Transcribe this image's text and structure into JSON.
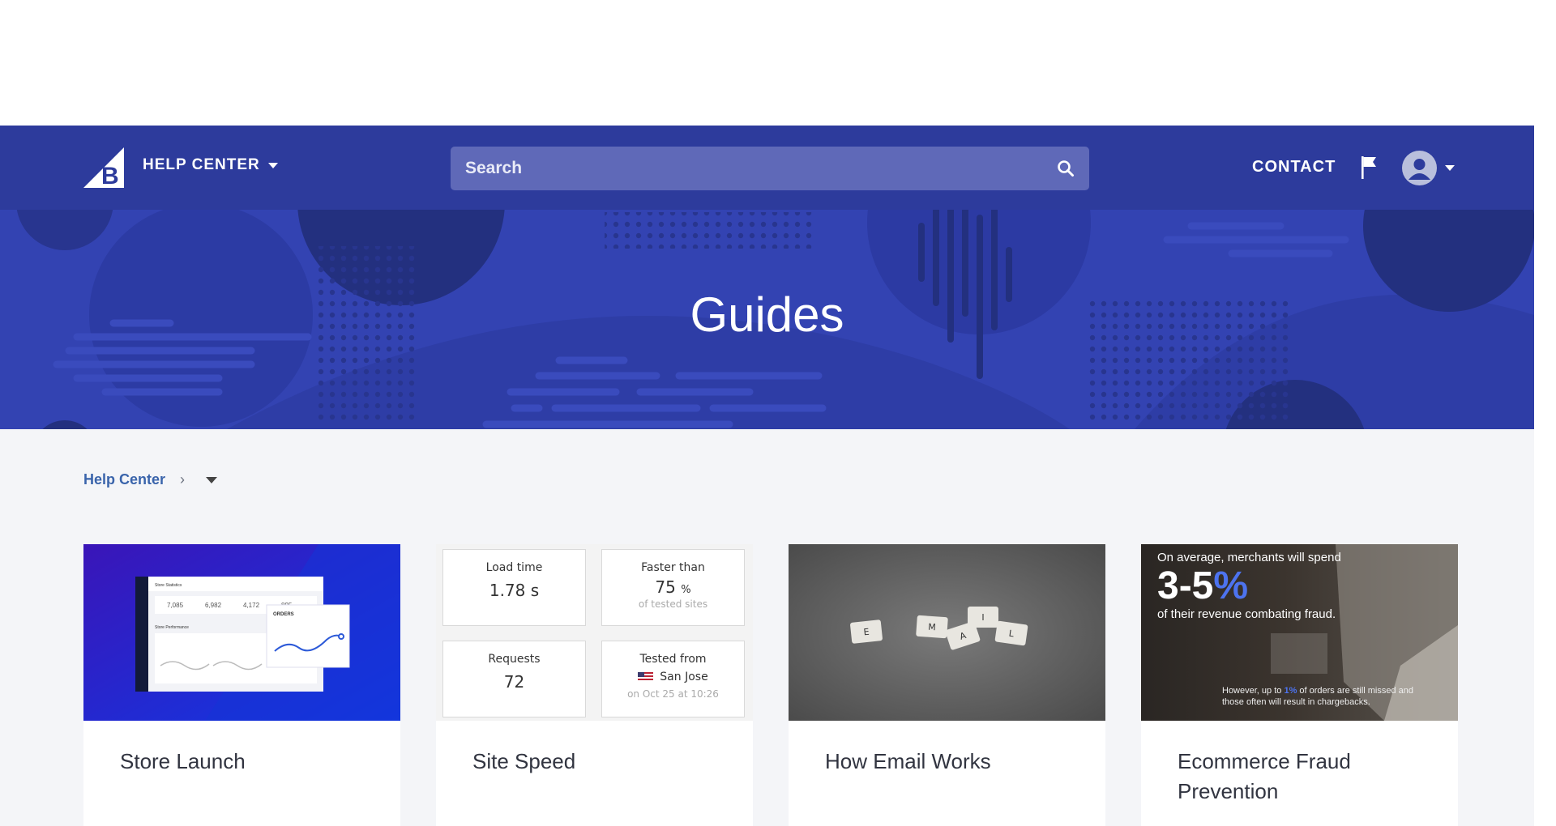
{
  "nav": {
    "help_center_label": "HELP CENTER",
    "search_placeholder": "Search",
    "contact_label": "CONTACT"
  },
  "hero": {
    "title": "Guides"
  },
  "breadcrumb": {
    "home": "Help Center",
    "separator": "›"
  },
  "cards": [
    {
      "title": "Store Launch",
      "image": {
        "stats": [
          "7,085",
          "6,982",
          "4,172",
          "895"
        ],
        "panel_label": "ORDERS",
        "header_label": "Store Statistics",
        "section_label": "Store Performance"
      }
    },
    {
      "title": "Site Speed",
      "image": {
        "load_time_label": "Load time",
        "load_time_value": "1.78 s",
        "faster_label": "Faster than",
        "faster_value": "75",
        "faster_unit": "%",
        "faster_sub": "of tested sites",
        "requests_label": "Requests",
        "requests_value": "72",
        "tested_label": "Tested from",
        "tested_location": "San Jose",
        "tested_date": "on Oct 25 at 10:26"
      }
    },
    {
      "title": "How Email Works",
      "image": {
        "tiles": [
          "E",
          "M",
          "A",
          "I",
          "L"
        ]
      }
    },
    {
      "title": "Ecommerce Fraud Prevention",
      "image": {
        "line1": "On average, merchants will spend",
        "big_number": "3-5",
        "big_pct": "%",
        "line2": "of their revenue combating fraud.",
        "footnote_pre": "However, up to ",
        "footnote_num": "1",
        "footnote_pct": "%",
        "footnote_post": " of orders are still missed and those often will result in chargebacks."
      }
    }
  ],
  "colors": {
    "nav_bg": "#2d3b9c",
    "hero_bg": "#3343b2",
    "content_bg": "#f4f5f8",
    "link": "#3a64ab",
    "accent_blue": "#4d73ef"
  }
}
